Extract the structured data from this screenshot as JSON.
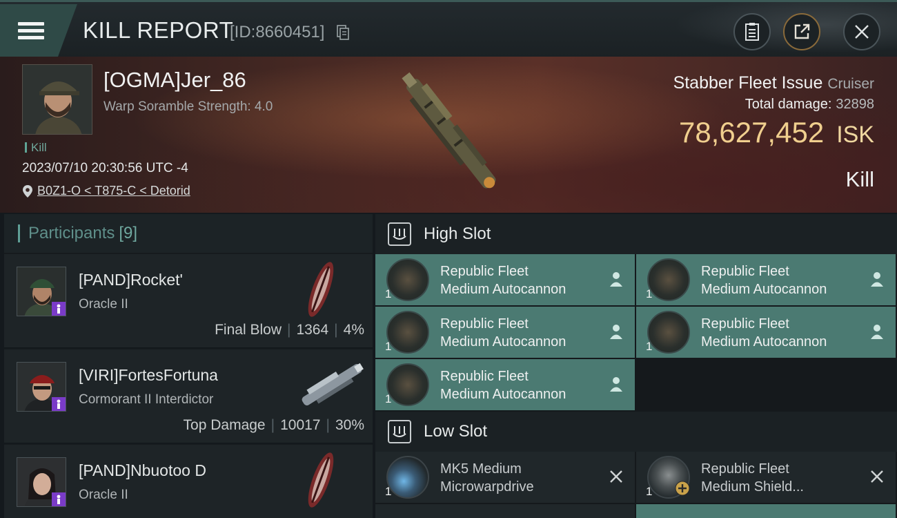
{
  "header": {
    "title": "KILL REPORT",
    "id_text": "[ID:8660451]",
    "icons": [
      "menu-icon",
      "copy-icon",
      "clipboard-icon",
      "share-icon",
      "close-icon"
    ]
  },
  "victim": {
    "name": "[OGMA]Jer_86",
    "subtitle": "Warp Soramble Strength: 4.0",
    "kill_tag": "Kill",
    "datetime": "2023/07/10 20:30:56 UTC -4",
    "location": "B0Z1-O < T875-C < Detorid",
    "ship": "Stabber Fleet Issue",
    "ship_class": "Cruiser",
    "total_damage_label": "Total damage:",
    "total_damage": "32898",
    "isk_value": "78,627,452",
    "isk_unit": "ISK",
    "result": "Kill"
  },
  "participants": {
    "label": "Participants",
    "count": "[9]",
    "rows": [
      {
        "name": "[PAND]Rocket'",
        "ship": "Oracle II",
        "role": "Final Blow",
        "damage": "1364",
        "percent": "4%"
      },
      {
        "name": "[VIRI]FortesFortuna",
        "ship": "Cormorant II Interdictor",
        "role": "Top Damage",
        "damage": "10017",
        "percent": "30%"
      },
      {
        "name": "[PAND]Nbuotoo D",
        "ship": "Oracle II",
        "role": "",
        "damage": "",
        "percent": ""
      }
    ]
  },
  "fitting": {
    "high_slot_label": "High Slot",
    "high_slot": [
      {
        "line1": "Republic Fleet",
        "line2": "Medium Autocannon",
        "qty": "1"
      },
      {
        "line1": "Republic Fleet",
        "line2": "Medium Autocannon",
        "qty": "1"
      },
      {
        "line1": "Republic Fleet",
        "line2": "Medium Autocannon",
        "qty": "1"
      },
      {
        "line1": "Republic Fleet",
        "line2": "Medium Autocannon",
        "qty": "1"
      },
      {
        "line1": "Republic Fleet",
        "line2": "Medium Autocannon",
        "qty": "1"
      }
    ],
    "low_slot_label": "Low Slot",
    "low_slot": [
      {
        "line1": "MK5 Medium",
        "line2": "Microwarpdrive",
        "qty": "1"
      },
      {
        "line1": "Republic Fleet",
        "line2": "Medium Shield...",
        "qty": "1"
      }
    ]
  },
  "colors": {
    "accent_teal": "#4b7a72",
    "isk_gold": "#f0cf8e",
    "badge_purple": "#7a3bc8"
  }
}
